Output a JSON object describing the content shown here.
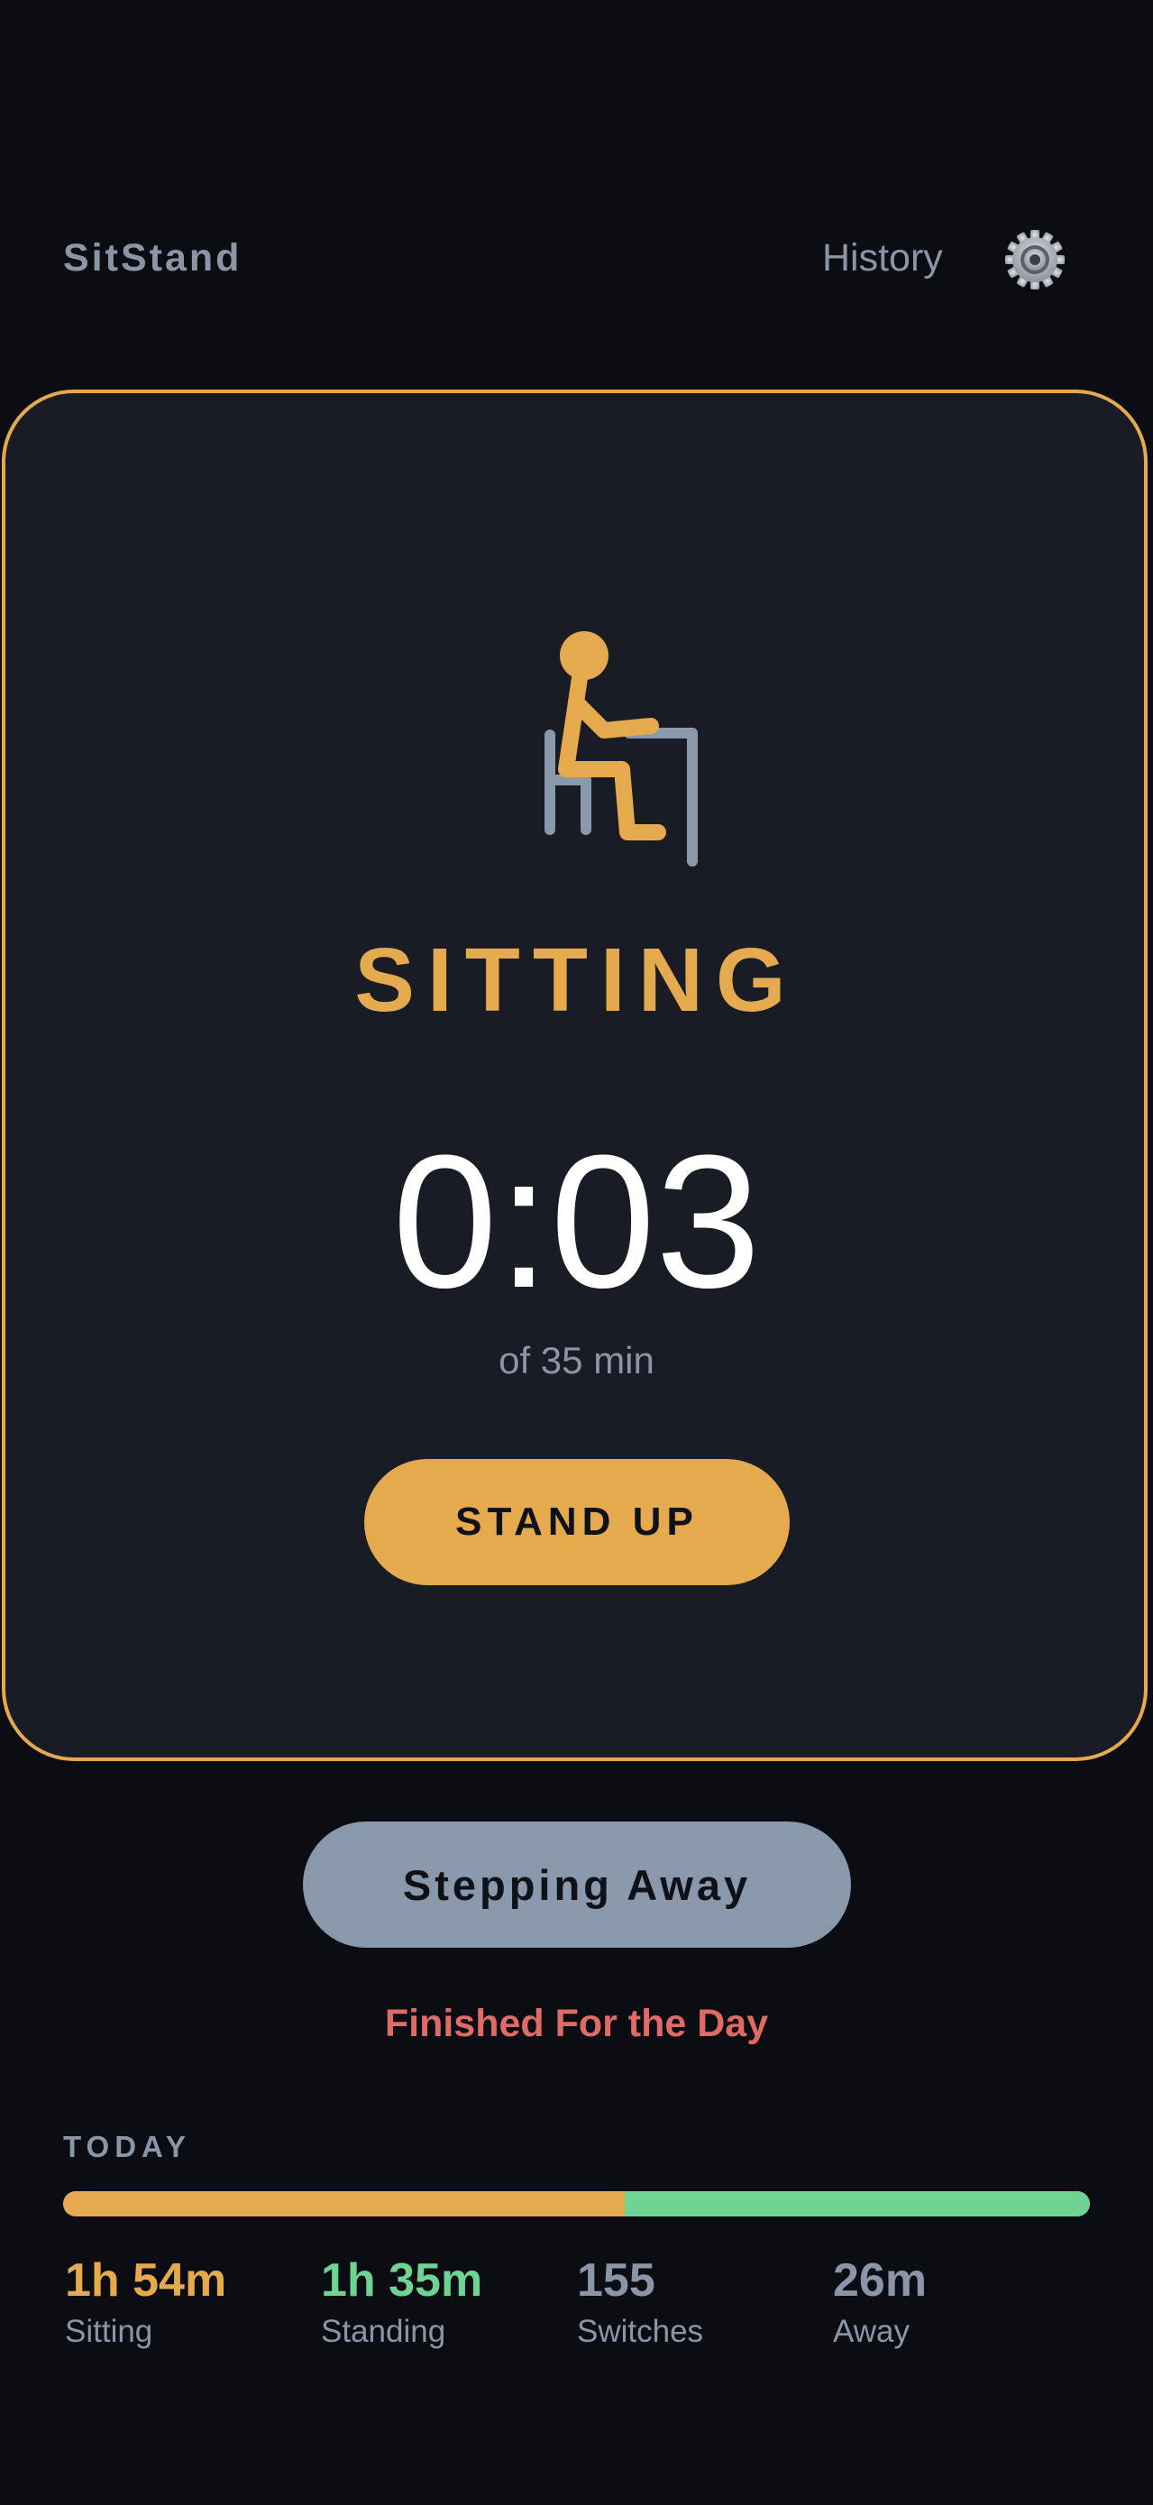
{
  "header": {
    "app_title": "SitStand",
    "history_label": "History",
    "settings_icon": "gear-icon"
  },
  "status": {
    "posture_icon": "sitting-at-desk-icon",
    "label": "SITTING",
    "timer": "0:03",
    "target": "of 35 min",
    "action_label": "STAND UP"
  },
  "secondary": {
    "away_label": "Stepping Away",
    "finish_label": "Finished For the Day"
  },
  "today": {
    "heading": "TODAY",
    "progress": {
      "sitting_fraction": 0.547,
      "standing_fraction": 0.453
    },
    "stats": [
      {
        "value": "1h 54m",
        "label": "Sitting"
      },
      {
        "value": "1h 35m",
        "label": "Standing"
      },
      {
        "value": "155",
        "label": "Switches"
      },
      {
        "value": "26m",
        "label": "Away"
      }
    ]
  },
  "colors": {
    "accent_sitting": "#e5a94e",
    "accent_standing": "#6fd394",
    "muted": "#8a96a8",
    "danger": "#e06a66",
    "background": "#0b0d12",
    "card": "#191c24"
  }
}
